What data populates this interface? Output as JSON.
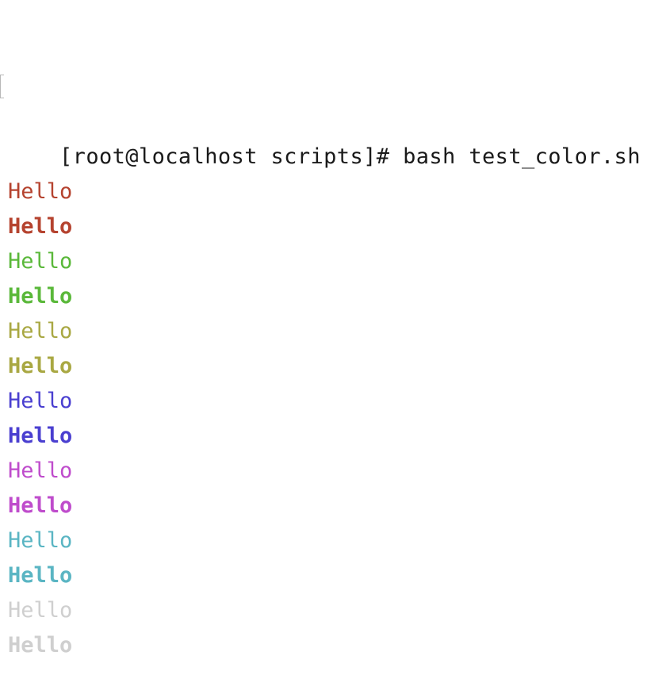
{
  "terminal": {
    "prompt": "[root@localhost scripts]# bash test_color.sh",
    "lines": [
      {
        "text": "Hello",
        "color": "#b5432f",
        "bold": false
      },
      {
        "text": "Hello",
        "color": "#b5432f",
        "bold": true
      },
      {
        "text": "Hello",
        "color": "#5ab83a",
        "bold": false
      },
      {
        "text": "Hello",
        "color": "#5ab83a",
        "bold": true
      },
      {
        "text": "Hello",
        "color": "#a9a843",
        "bold": false
      },
      {
        "text": "Hello",
        "color": "#a9a843",
        "bold": true
      },
      {
        "text": "Hello",
        "color": "#4a3fd0",
        "bold": false
      },
      {
        "text": "Hello",
        "color": "#4a3fd0",
        "bold": true
      },
      {
        "text": "Hello",
        "color": "#bf4ccc",
        "bold": false
      },
      {
        "text": "Hello",
        "color": "#bf4ccc",
        "bold": true
      },
      {
        "text": "Hello",
        "color": "#5ab5c3",
        "bold": false
      },
      {
        "text": "Hello",
        "color": "#5ab5c3",
        "bold": true
      },
      {
        "text": "Hello",
        "color": "#cfcfcf",
        "bold": false
      },
      {
        "text": "Hello",
        "color": "#cfcfcf",
        "bold": true
      }
    ]
  }
}
